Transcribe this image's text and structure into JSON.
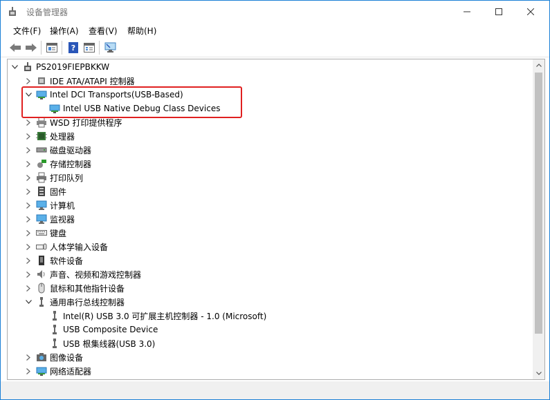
{
  "window": {
    "title": "设备管理器"
  },
  "menu": [
    "文件(F)",
    "操作(A)",
    "查看(V)",
    "帮助(H)"
  ],
  "toolbar": {
    "buttons": [
      "back-icon",
      "forward-icon",
      "properties-icon",
      "help-icon",
      "view-icon",
      "monitor-scan-icon"
    ]
  },
  "tree": {
    "root": "PS2019FIEPBKKW",
    "items": [
      {
        "label": "IDE ATA/ATAPI 控制器",
        "expanded": false,
        "icon": "ide-controller-icon"
      },
      {
        "label": "Intel DCI Transports(USB-Based)",
        "expanded": true,
        "icon": "network-card-icon"
      },
      {
        "label": "Intel USB Native Debug Class Devices",
        "child": true,
        "icon": "network-card-icon"
      },
      {
        "label": "WSD 打印提供程序",
        "expanded": false,
        "icon": "printer-icon"
      },
      {
        "label": "处理器",
        "expanded": false,
        "icon": "processor-icon"
      },
      {
        "label": "磁盘驱动器",
        "expanded": false,
        "icon": "disk-drive-icon"
      },
      {
        "label": "存储控制器",
        "expanded": false,
        "icon": "storage-controller-icon"
      },
      {
        "label": "打印队列",
        "expanded": false,
        "icon": "print-queue-icon"
      },
      {
        "label": "固件",
        "expanded": false,
        "icon": "firmware-icon"
      },
      {
        "label": "计算机",
        "expanded": false,
        "icon": "computer-icon"
      },
      {
        "label": "监视器",
        "expanded": false,
        "icon": "monitor-icon"
      },
      {
        "label": "键盘",
        "expanded": false,
        "icon": "keyboard-icon"
      },
      {
        "label": "人体学输入设备",
        "expanded": false,
        "icon": "hid-icon"
      },
      {
        "label": "软件设备",
        "expanded": false,
        "icon": "software-device-icon"
      },
      {
        "label": "声音、视频和游戏控制器",
        "expanded": false,
        "icon": "sound-icon"
      },
      {
        "label": "鼠标和其他指针设备",
        "expanded": false,
        "icon": "mouse-icon"
      },
      {
        "label": "通用串行总线控制器",
        "expanded": true,
        "icon": "usb-icon"
      },
      {
        "label": "Intel(R) USB 3.0 可扩展主机控制器 - 1.0 (Microsoft)",
        "child": true,
        "icon": "usb-icon"
      },
      {
        "label": "USB Composite Device",
        "child": true,
        "icon": "usb-icon"
      },
      {
        "label": "USB 根集线器(USB 3.0)",
        "child": true,
        "icon": "usb-icon"
      },
      {
        "label": "图像设备",
        "expanded": false,
        "icon": "camera-icon"
      },
      {
        "label": "网络适配器",
        "expanded": false,
        "icon": "network-adapter-icon"
      }
    ]
  },
  "colors": {
    "highlight": "#e02020",
    "accent": "#1a7fd6"
  }
}
